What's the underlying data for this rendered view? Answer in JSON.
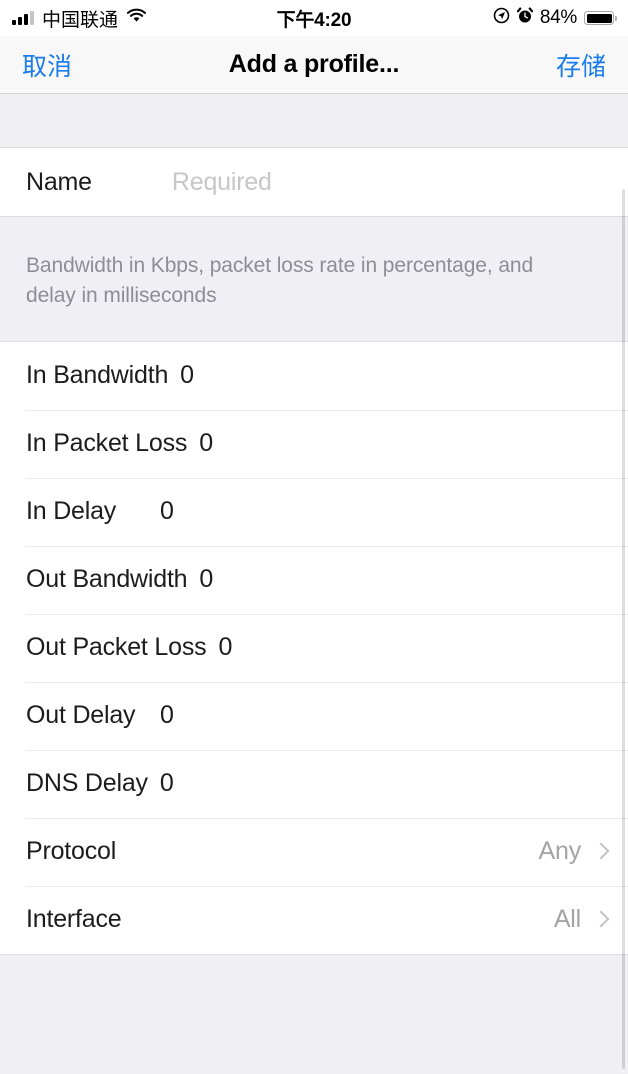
{
  "status_bar": {
    "carrier": "中国联通",
    "signal_icon": "signal-bars-icon",
    "wifi_icon": "wifi-icon",
    "time": "下午4:20",
    "location_icon": "location-arrow-icon",
    "alarm_icon": "alarm-clock-icon",
    "battery_percent": "84%",
    "battery_icon": "battery-icon"
  },
  "nav_bar": {
    "cancel_label": "取消",
    "title": "Add a profile...",
    "save_label": "存储",
    "accent_color": "#1a7ced"
  },
  "name_section": {
    "label": "Name",
    "value": "",
    "placeholder": "Required"
  },
  "note": "Bandwidth in Kbps, packet loss rate in percentage, and delay in milliseconds",
  "settings_rows": [
    {
      "label": "In Bandwidth",
      "value": "0"
    },
    {
      "label": "In Packet Loss",
      "value": "0"
    },
    {
      "label": "In Delay",
      "value": "0"
    },
    {
      "label": "Out Bandwidth",
      "value": "0"
    },
    {
      "label": "Out Packet Loss",
      "value": "0"
    },
    {
      "label": "Out Delay",
      "value": "0"
    },
    {
      "label": "DNS Delay",
      "value": "0"
    }
  ],
  "disclosure_rows": [
    {
      "label": "Protocol",
      "detail": "Any",
      "chevron_icon": "chevron-right-icon"
    },
    {
      "label": "Interface",
      "detail": "All",
      "chevron_icon": "chevron-right-icon"
    }
  ]
}
